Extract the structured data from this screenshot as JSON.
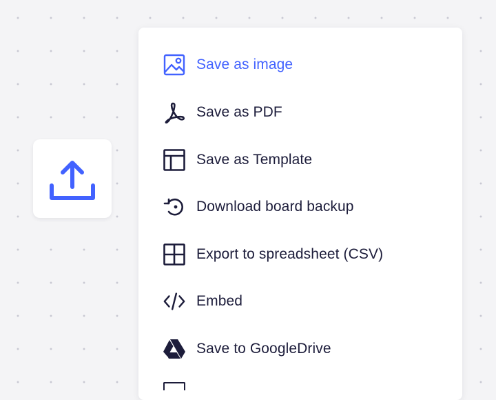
{
  "export_button": {
    "icon": "upload-icon",
    "color": "#4262ff"
  },
  "menu": {
    "accent_color": "#4262ff",
    "text_color": "#1c1c3a",
    "items": [
      {
        "label": "Save as image",
        "icon": "image-icon",
        "active": true
      },
      {
        "label": "Save as PDF",
        "icon": "pdf-icon",
        "active": false
      },
      {
        "label": "Save as Template",
        "icon": "template-icon",
        "active": false
      },
      {
        "label": "Download board backup",
        "icon": "backup-restore-icon",
        "active": false
      },
      {
        "label": "Export to spreadsheet (CSV)",
        "icon": "table-grid-icon",
        "active": false
      },
      {
        "label": "Embed",
        "icon": "code-icon",
        "active": false
      },
      {
        "label": "Save to GoogleDrive",
        "icon": "google-drive-icon",
        "active": false
      }
    ]
  }
}
